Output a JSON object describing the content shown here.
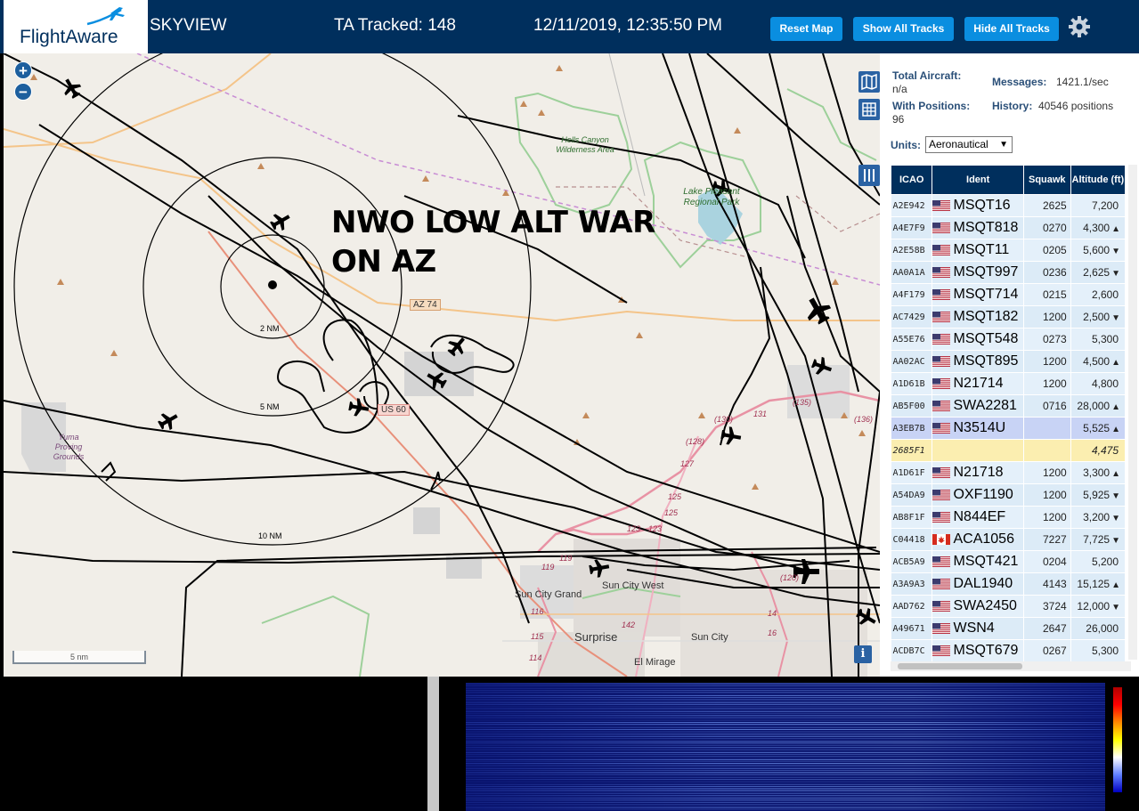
{
  "header": {
    "logo_text": "FlightAware",
    "app_title": "SKYVIEW",
    "tracked": "TA Tracked: 148",
    "datetime": "12/11/2019, 12:35:50 PM",
    "reset_map_label": "Reset Map",
    "show_tracks_label": "Show All Tracks",
    "hide_tracks_label": "Hide All Tracks",
    "settings_icon": "gear-icon"
  },
  "map": {
    "overlay_title_line1": "NWO LOW ALT WAR",
    "overlay_title_line2": "ON AZ",
    "range_labels": [
      "2 NM",
      "5 NM",
      "10 NM"
    ],
    "place_labels": {
      "hells_canyon": "Hells Canyon Wilderness Area",
      "lake_pleasant": "Lake Pleasant Regional Park",
      "yuma_proving": "Yuma Proving Grounds",
      "sun_city_grand": "Sun City Grand",
      "sun_city_west": "Sun City West",
      "sun_city": "Sun City",
      "surprise": "Surprise",
      "el_mirage": "El Mirage"
    },
    "road_labels": [
      "AZ 74",
      "US 60",
      "(135)",
      "(130)",
      "131",
      "(136)",
      "(128)",
      "127",
      "125",
      "125",
      "123",
      "123",
      "119",
      "119",
      "116",
      "115",
      "114",
      "142",
      "14",
      "16",
      "(120)"
    ],
    "scale_label": "5 nm",
    "zoom_in": "+",
    "zoom_out": "−",
    "info_label": "i"
  },
  "stats": {
    "total_aircraft_label": "Total Aircraft:",
    "total_aircraft_value": "n/a",
    "with_positions_label": "With Positions:",
    "with_positions_value": "96",
    "messages_label": "Messages:",
    "messages_value": "1421.1/sec",
    "history_label": "History:",
    "history_value": "40546 positions",
    "units_label": "Units:",
    "units_value": "Aeronautical"
  },
  "table": {
    "headers": [
      "ICAO",
      "Ident",
      "Squawk",
      "Altitude (ft)"
    ],
    "rows": [
      {
        "icao": "A2E942",
        "flag": "us",
        "ident": "MSQT16",
        "squawk": "2625",
        "alt": "7,200",
        "trend": ""
      },
      {
        "icao": "A4E7F9",
        "flag": "us",
        "ident": "MSQT818",
        "squawk": "0270",
        "alt": "4,300",
        "trend": "▲"
      },
      {
        "icao": "A2E58B",
        "flag": "us",
        "ident": "MSQT11",
        "squawk": "0205",
        "alt": "5,600",
        "trend": "▼"
      },
      {
        "icao": "AA0A1A",
        "flag": "us",
        "ident": "MSQT997",
        "squawk": "0236",
        "alt": "2,625",
        "trend": "▼"
      },
      {
        "icao": "A4F179",
        "flag": "us",
        "ident": "MSQT714",
        "squawk": "0215",
        "alt": "2,600",
        "trend": ""
      },
      {
        "icao": "AC7429",
        "flag": "us",
        "ident": "MSQT182",
        "squawk": "1200",
        "alt": "2,500",
        "trend": "▼"
      },
      {
        "icao": "A55E76",
        "flag": "us",
        "ident": "MSQT548",
        "squawk": "0273",
        "alt": "5,300",
        "trend": ""
      },
      {
        "icao": "AA02AC",
        "flag": "us",
        "ident": "MSQT895",
        "squawk": "1200",
        "alt": "4,500",
        "trend": "▲"
      },
      {
        "icao": "A1D61B",
        "flag": "us",
        "ident": "N21714",
        "squawk": "1200",
        "alt": "4,800",
        "trend": ""
      },
      {
        "icao": "AB5F00",
        "flag": "us",
        "ident": "SWA2281",
        "squawk": "0716",
        "alt": "28,000",
        "trend": "▲"
      },
      {
        "icao": "A3EB7B",
        "flag": "us",
        "ident": "N3514U",
        "squawk": "",
        "alt": "5,525",
        "trend": "▲",
        "selected": true
      },
      {
        "icao": "2685F1",
        "flag": "",
        "ident": "",
        "squawk": "",
        "alt": "4,475",
        "trend": "",
        "mlat": true
      },
      {
        "icao": "A1D61F",
        "flag": "us",
        "ident": "N21718",
        "squawk": "1200",
        "alt": "3,300",
        "trend": "▲"
      },
      {
        "icao": "A54DA9",
        "flag": "us",
        "ident": "OXF1190",
        "squawk": "1200",
        "alt": "5,925",
        "trend": "▼"
      },
      {
        "icao": "AB8F1F",
        "flag": "us",
        "ident": "N844EF",
        "squawk": "1200",
        "alt": "3,200",
        "trend": "▼"
      },
      {
        "icao": "C04418",
        "flag": "ca",
        "ident": "ACA1056",
        "squawk": "7227",
        "alt": "7,725",
        "trend": "▼"
      },
      {
        "icao": "ACB5A9",
        "flag": "us",
        "ident": "MSQT421",
        "squawk": "0204",
        "alt": "5,200",
        "trend": ""
      },
      {
        "icao": "A3A9A3",
        "flag": "us",
        "ident": "DAL1940",
        "squawk": "4143",
        "alt": "15,125",
        "trend": "▲"
      },
      {
        "icao": "AAD762",
        "flag": "us",
        "ident": "SWA2450",
        "squawk": "3724",
        "alt": "12,000",
        "trend": "▼"
      },
      {
        "icao": "A49671",
        "flag": "us",
        "ident": "WSN4",
        "squawk": "2647",
        "alt": "26,000",
        "trend": ""
      },
      {
        "icao": "ACDB7C",
        "flag": "us",
        "ident": "MSQT679",
        "squawk": "0267",
        "alt": "5,300",
        "trend": ""
      }
    ]
  },
  "colors": {
    "header_bg": "#002f5d",
    "button_bg": "#0a8ee0",
    "table_header_bg": "#002f5d",
    "track_color": "#000000",
    "spectrum_bg": "#07116b"
  }
}
